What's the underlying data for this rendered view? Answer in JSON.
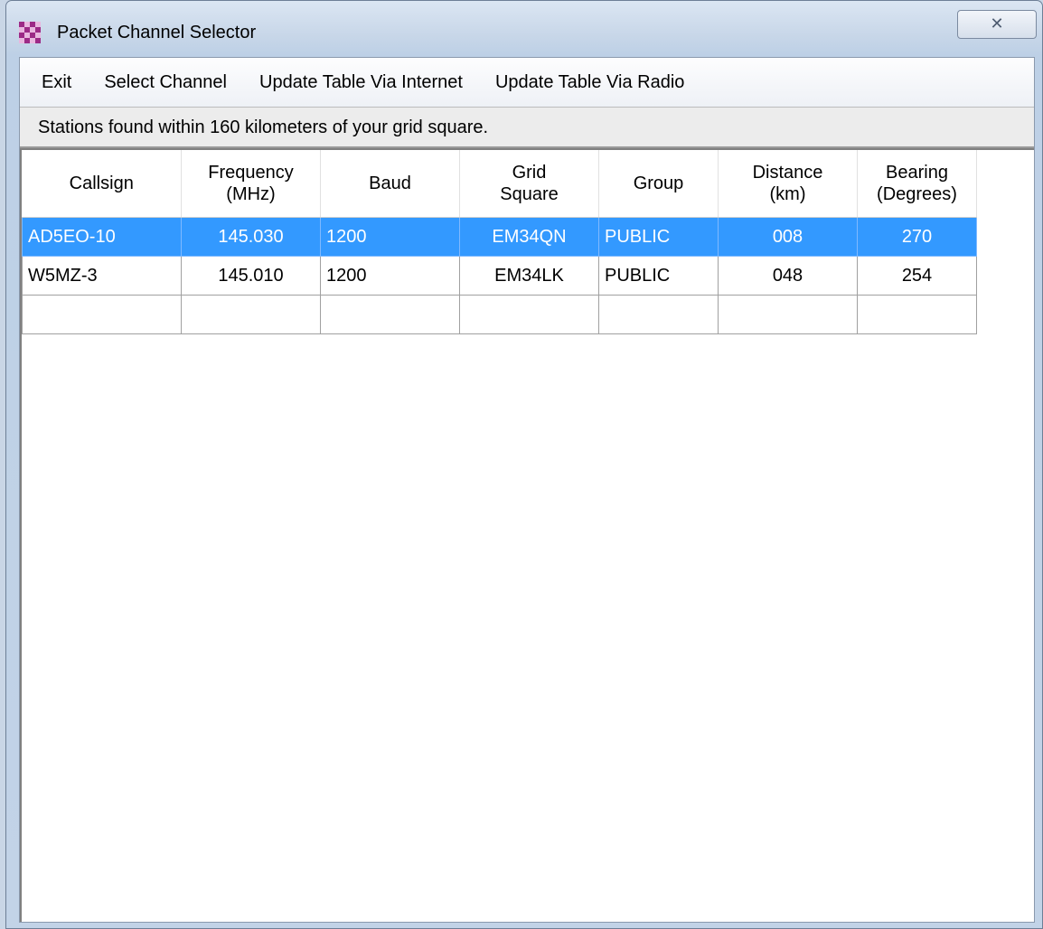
{
  "window": {
    "title": "Packet Channel Selector",
    "close_label": "✕"
  },
  "menu": {
    "items": [
      "Exit",
      "Select Channel",
      "Update Table Via Internet",
      "Update Table Via Radio"
    ]
  },
  "status_text": "Stations found within 160 kilometers of your grid square.",
  "table": {
    "headers": [
      [
        "Callsign"
      ],
      [
        "Frequency",
        "(MHz)"
      ],
      [
        "Baud"
      ],
      [
        "Grid",
        "Square"
      ],
      [
        "Group"
      ],
      [
        "Distance",
        "(km)"
      ],
      [
        "Bearing",
        "(Degrees)"
      ]
    ],
    "rows": [
      [
        "AD5EO-10",
        "145.030",
        "1200",
        "EM34QN",
        "PUBLIC",
        "008",
        "270"
      ],
      [
        "W5MZ-3",
        "145.010",
        "1200",
        "EM34LK",
        "PUBLIC",
        "048",
        "254"
      ],
      [
        "",
        "",
        "",
        "",
        "",
        "",
        ""
      ]
    ],
    "selected_row": 0
  },
  "colors": {
    "selection": "#3399ff",
    "app_icon": "#9c2a86"
  }
}
